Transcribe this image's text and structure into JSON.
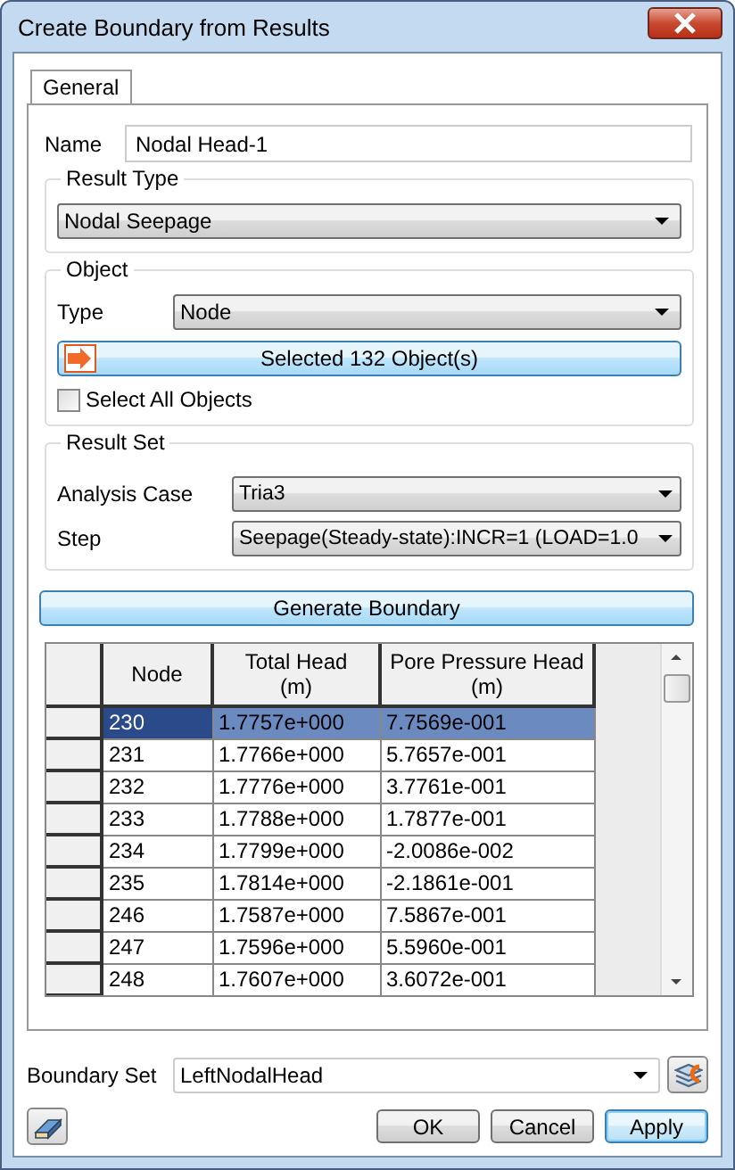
{
  "window": {
    "title": "Create Boundary from Results"
  },
  "tabs": [
    {
      "label": "General",
      "selected": true
    }
  ],
  "name": {
    "label": "Name",
    "value": "Nodal Head-1"
  },
  "result_type": {
    "title": "Result Type",
    "value": "Nodal Seepage"
  },
  "object": {
    "title": "Object",
    "type_label": "Type",
    "type_value": "Node",
    "selected_button": "Selected 132 Object(s)",
    "select_all": {
      "label": "Select All Objects",
      "checked": false
    }
  },
  "result_set": {
    "title": "Result Set",
    "fields": [
      {
        "label": "Analysis Case",
        "value": "Tria3"
      },
      {
        "label": "Step",
        "value": "Seepage(Steady-state):INCR=1 (LOAD=1.0"
      }
    ]
  },
  "generate_button": "Generate Boundary",
  "table": {
    "columns": [
      {
        "title": "Node"
      },
      {
        "title": "Total Head",
        "unit": "(m)"
      },
      {
        "title": "Pore Pressure Head",
        "unit": "(m)"
      }
    ],
    "rows": [
      {
        "selected": true,
        "cells": [
          "230",
          "1.7757e+000",
          "7.7569e-001"
        ]
      },
      {
        "selected": false,
        "cells": [
          "231",
          "1.7766e+000",
          "5.7657e-001"
        ]
      },
      {
        "selected": false,
        "cells": [
          "232",
          "1.7776e+000",
          "3.7761e-001"
        ]
      },
      {
        "selected": false,
        "cells": [
          "233",
          "1.7788e+000",
          "1.7877e-001"
        ]
      },
      {
        "selected": false,
        "cells": [
          "234",
          "1.7799e+000",
          "-2.0086e-002"
        ]
      },
      {
        "selected": false,
        "cells": [
          "235",
          "1.7814e+000",
          "-2.1861e-001"
        ]
      },
      {
        "selected": false,
        "cells": [
          "246",
          "1.7587e+000",
          "7.5867e-001"
        ]
      },
      {
        "selected": false,
        "cells": [
          "247",
          "1.7596e+000",
          "5.5960e-001"
        ]
      },
      {
        "selected": false,
        "cells": [
          "248",
          "1.7607e+000",
          "3.6072e-001"
        ]
      }
    ]
  },
  "boundary_set": {
    "label": "Boundary Set",
    "value": "LeftNodalHead"
  },
  "buttons": [
    {
      "label": "OK",
      "default": false
    },
    {
      "label": "Cancel",
      "default": false
    },
    {
      "label": "Apply",
      "default": true
    }
  ]
}
